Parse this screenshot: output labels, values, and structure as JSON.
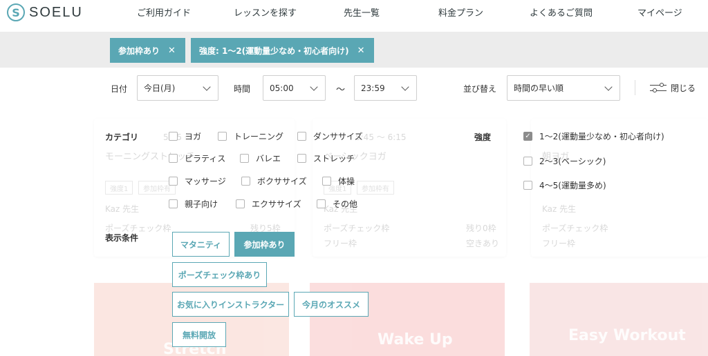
{
  "header": {
    "logo": "SOELU",
    "nav": [
      "ご利用ガイド",
      "レッスンを探す",
      "先生一覧",
      "料金プラン",
      "よくあるご質問",
      "マイページ"
    ]
  },
  "chips": [
    {
      "label": "参加枠あり"
    },
    {
      "label": "強度: 1～2(運動量少なめ・初心者向け)"
    }
  ],
  "filters": {
    "date_label": "日付",
    "date_value": "今日(月)",
    "time_label": "時間",
    "time_from": "05:00",
    "tilde": "～",
    "time_to": "23:59",
    "sort_label": "並び替え",
    "sort_value": "時間の早い順",
    "close_label": "閉じる"
  },
  "background": {
    "card1_time": "5:45 ～",
    "card1_title": "モーニングストレッチ",
    "card2_time": "5:45 ～ 6:15",
    "card2_title": "ベーシックヨガ",
    "card3_title": "朝ヨガ",
    "teacher": "Kaz 先生",
    "pose_check": "ポーズチェック枠",
    "pose_value": "残り5枠",
    "pose_value2": "残り0枠",
    "free_label": "フリー枠",
    "free_value": "空きあり",
    "tag1": "強度1",
    "tag2": "参加枠有",
    "banner2": "Wake Up",
    "banner3": "Easy Workout",
    "banner1": "Stretch"
  },
  "panel": {
    "category_label": "カテゴリ",
    "categories": [
      "ヨガ",
      "トレーニング",
      "ダンササイズ",
      "ピラティス",
      "バレエ",
      "ストレッチ",
      "マッサージ",
      "ボクササイズ",
      "体操",
      "親子向け",
      "エクササイズ",
      "その他"
    ],
    "intensity_label": "強度",
    "intensities": [
      {
        "label": "1～2(運動量少なめ・初心者向け)",
        "checked": true
      },
      {
        "label": "2～3(ベーシック)",
        "checked": false
      },
      {
        "label": "4～5(運動量多め)",
        "checked": false
      }
    ],
    "display_label": "表示条件",
    "options": [
      {
        "label": "マタニティ",
        "active": false
      },
      {
        "label": "参加枠あり",
        "active": true
      },
      {
        "label": "ポーズチェック枠あり",
        "active": false
      },
      {
        "label": "お気に入りインストラクター",
        "active": false
      },
      {
        "label": "今月のオススメ",
        "active": false
      },
      {
        "label": "無料開放",
        "active": false
      }
    ]
  },
  "colors": {
    "accent": "#5aa7b4",
    "band": "#ececec"
  }
}
